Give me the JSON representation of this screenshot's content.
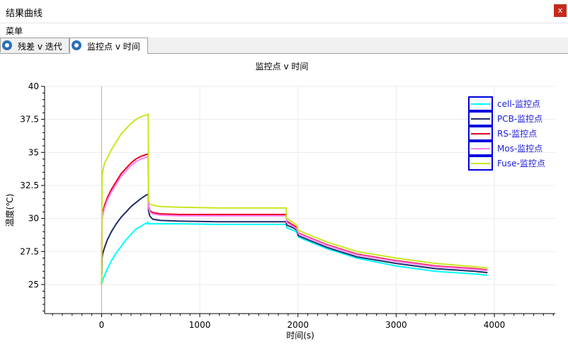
{
  "window": {
    "title": "结果曲线",
    "close_label": "x"
  },
  "menu": {
    "items": [
      "菜单"
    ]
  },
  "tabs": [
    {
      "label": "残差 v 迭代",
      "active": false
    },
    {
      "label": "监控点 v 时间",
      "active": true
    }
  ],
  "chart_data": {
    "type": "line",
    "title": "监控点 v 时间",
    "xlabel": "时间(s)",
    "ylabel": "温度(℃)",
    "xlim": [
      -580,
      4620
    ],
    "ylim": [
      22.8,
      40
    ],
    "xticks": [
      0,
      1000,
      2000,
      3000,
      4000
    ],
    "yticks": [
      25,
      27.5,
      30,
      32.5,
      35,
      37.5,
      40
    ],
    "xtick_labels": [
      "0",
      "1000",
      "2000",
      "3000",
      "4000"
    ],
    "ytick_labels": [
      "25",
      "27.5",
      "30",
      "32.5",
      "35",
      "37.5",
      "40"
    ],
    "grid": true,
    "legend_position": "top-right",
    "series": [
      {
        "name": "cell-监控点",
        "color": "#00ffff",
        "x": [
          0,
          10,
          30,
          60,
          100,
          150,
          200,
          250,
          300,
          350,
          400,
          440,
          460,
          475,
          478,
          490,
          520,
          600,
          800,
          1200,
          1600,
          1880,
          1885,
          1950,
          1990,
          2000,
          2005,
          2100,
          2300,
          2600,
          3000,
          3400,
          3800,
          3930
        ],
        "y": [
          25,
          25.3,
          25.7,
          26.2,
          26.8,
          27.4,
          27.9,
          28.4,
          28.8,
          29.2,
          29.4,
          29.6,
          29.65,
          29.7,
          29.6,
          29.6,
          29.6,
          29.6,
          29.6,
          29.55,
          29.55,
          29.55,
          29.3,
          29.1,
          28.95,
          28.7,
          28.6,
          28.3,
          27.7,
          27.0,
          26.4,
          26.0,
          25.8,
          25.7
        ]
      },
      {
        "name": "PCB-监控点",
        "color": "#1f2d6b",
        "x": [
          0,
          5,
          10,
          30,
          60,
          100,
          150,
          200,
          250,
          300,
          350,
          400,
          440,
          460,
          475,
          478,
          490,
          520,
          600,
          800,
          1200,
          1600,
          1880,
          1885,
          1950,
          1990,
          2000,
          2005,
          2100,
          2300,
          2600,
          3000,
          3400,
          3800,
          3930
        ],
        "y": [
          25,
          27.0,
          27.3,
          27.8,
          28.4,
          29.0,
          29.6,
          30.1,
          30.5,
          30.9,
          31.2,
          31.5,
          31.7,
          31.8,
          31.8,
          30.6,
          30.2,
          29.95,
          29.85,
          29.8,
          29.75,
          29.75,
          29.75,
          29.5,
          29.3,
          29.1,
          28.8,
          28.7,
          28.4,
          27.8,
          27.1,
          26.6,
          26.2,
          26.0,
          25.9
        ]
      },
      {
        "name": "RS-监控点",
        "color": "#e8001c",
        "x": [
          0,
          5,
          10,
          30,
          60,
          100,
          150,
          200,
          250,
          300,
          350,
          400,
          440,
          460,
          475,
          478,
          490,
          520,
          600,
          800,
          1200,
          1600,
          1880,
          1885,
          1950,
          1990,
          2000,
          2005,
          2100,
          2300,
          2600,
          3000,
          3400,
          3800,
          3930
        ],
        "y": [
          25,
          30.1,
          30.4,
          31.0,
          31.6,
          32.2,
          32.8,
          33.4,
          33.8,
          34.2,
          34.5,
          34.7,
          34.8,
          34.85,
          34.9,
          31.0,
          30.6,
          30.45,
          30.35,
          30.3,
          30.3,
          30.3,
          30.3,
          29.8,
          29.5,
          29.3,
          29.0,
          28.9,
          28.6,
          28.0,
          27.3,
          26.8,
          26.4,
          26.2,
          26.1
        ]
      },
      {
        "name": "Mos-监控点",
        "color": "#ff80ff",
        "x": [
          0,
          5,
          10,
          30,
          60,
          100,
          150,
          200,
          250,
          300,
          350,
          400,
          440,
          460,
          475,
          478,
          490,
          520,
          600,
          800,
          1200,
          1600,
          1880,
          1885,
          1950,
          1990,
          2000,
          2005,
          2100,
          2300,
          2600,
          3000,
          3400,
          3800,
          3930
        ],
        "y": [
          25,
          29.9,
          30.2,
          30.8,
          31.4,
          32.0,
          32.6,
          33.2,
          33.6,
          34.0,
          34.3,
          34.5,
          34.6,
          34.65,
          34.7,
          30.9,
          30.5,
          30.35,
          30.25,
          30.2,
          30.2,
          30.2,
          30.2,
          29.7,
          29.4,
          29.2,
          28.95,
          28.85,
          28.55,
          27.95,
          27.25,
          26.75,
          26.35,
          26.15,
          26.05
        ]
      },
      {
        "name": "Fuse-监控点",
        "color": "#c8e81e",
        "x": [
          0,
          5,
          10,
          30,
          60,
          100,
          150,
          200,
          250,
          300,
          350,
          400,
          440,
          460,
          475,
          478,
          490,
          520,
          600,
          800,
          1200,
          1600,
          1880,
          1885,
          1950,
          1990,
          2000,
          2005,
          2100,
          2300,
          2600,
          3000,
          3400,
          3800,
          3930
        ],
        "y": [
          25,
          33.2,
          33.5,
          34.2,
          34.6,
          35.2,
          35.8,
          36.4,
          36.8,
          37.2,
          37.5,
          37.7,
          37.8,
          37.85,
          37.9,
          31.4,
          31.1,
          31.0,
          30.9,
          30.85,
          30.8,
          30.8,
          30.8,
          30.0,
          29.7,
          29.45,
          29.2,
          29.1,
          28.8,
          28.2,
          27.5,
          27.0,
          26.6,
          26.35,
          26.25
        ]
      }
    ]
  }
}
